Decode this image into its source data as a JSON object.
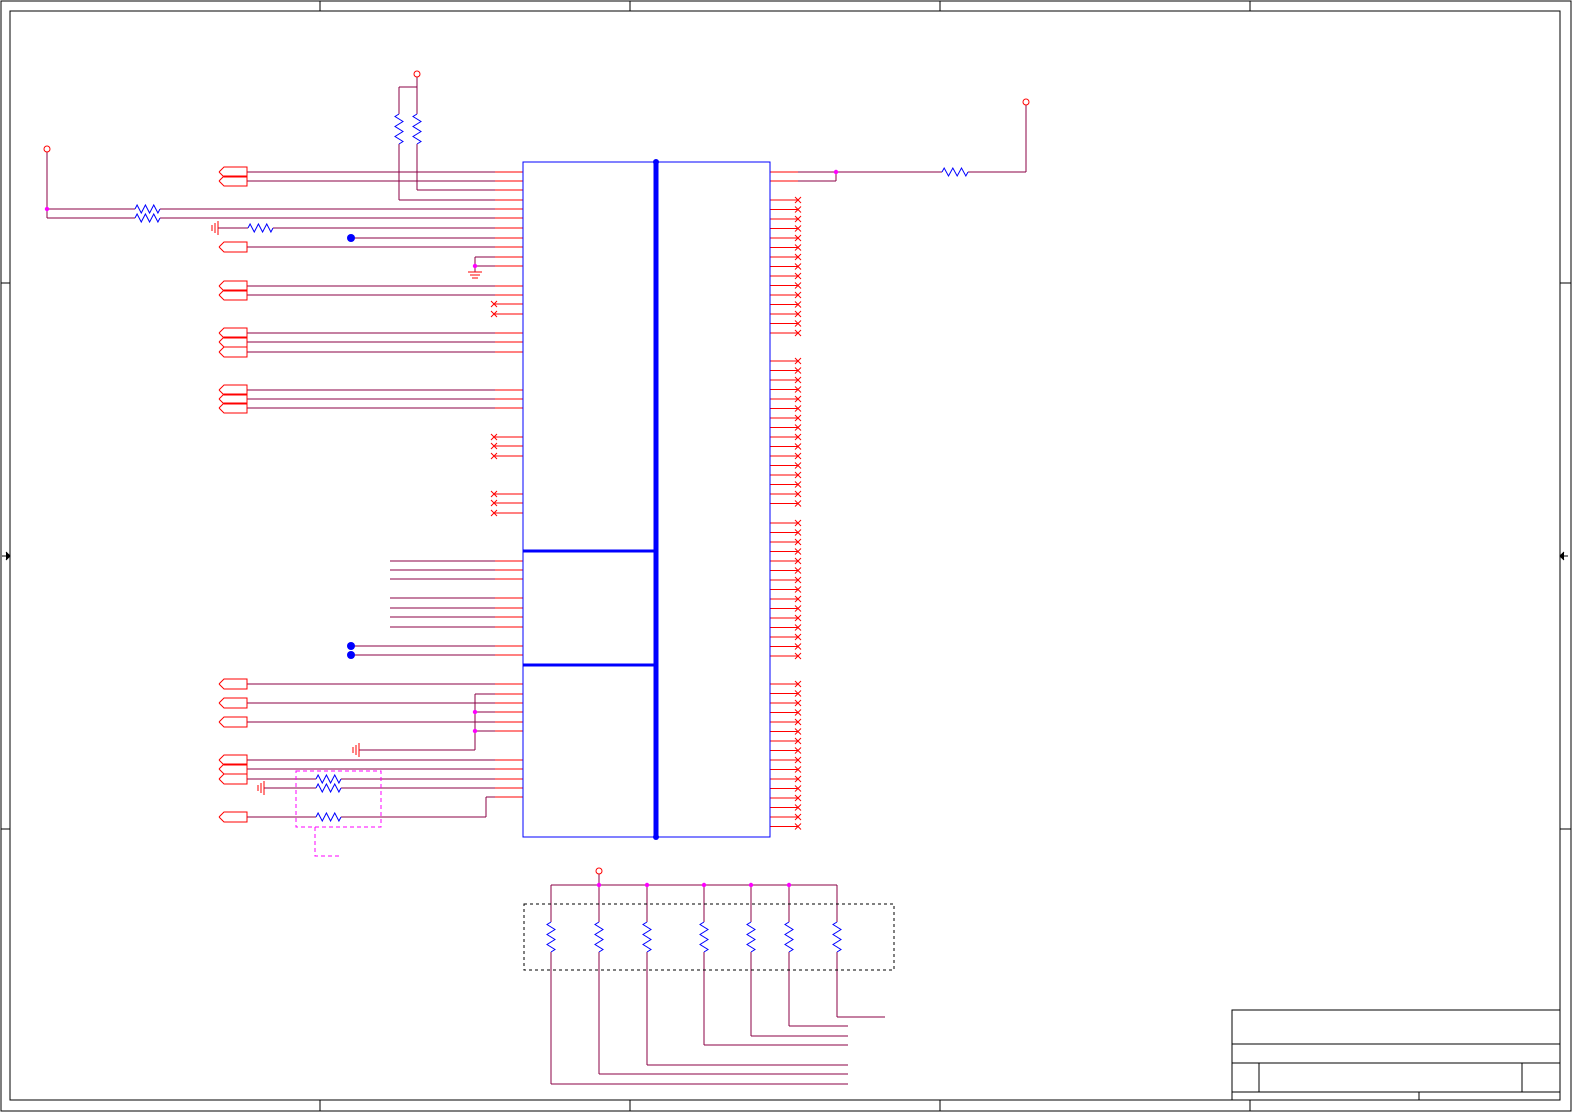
{
  "sheet": {
    "colors": {
      "background": "#ffffff",
      "frame": "#000000",
      "wire": "#8b0046",
      "pin": "#ff0000",
      "component": "#0000ff",
      "junction": "#ff00ff",
      "bus": "#0000ff",
      "group_box": "#ff00ff",
      "pullup_box": "#000000"
    },
    "title_block": {
      "title": "",
      "size": "",
      "document_number": "",
      "revision": "",
      "date": "",
      "sheet": ""
    }
  }
}
